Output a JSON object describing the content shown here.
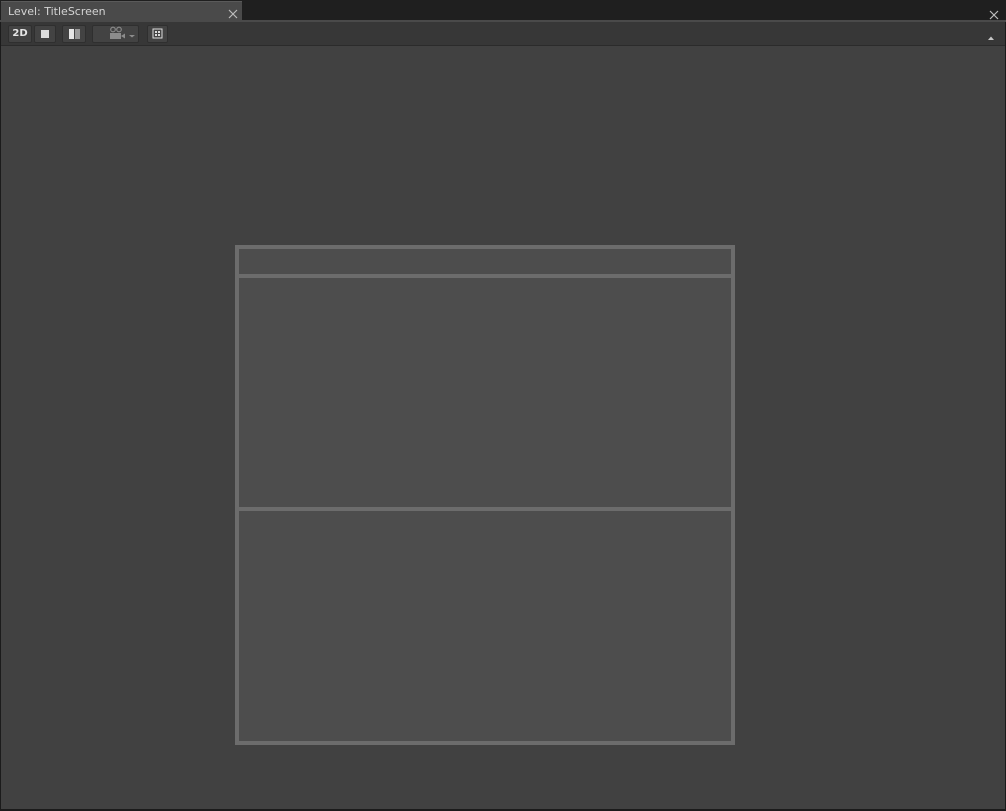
{
  "tab": {
    "title": "Level: TitleScreen"
  },
  "toolbar": {
    "mode_2d_label": "2D",
    "buttons": [
      {
        "name": "view-2d",
        "icon": "text-2d"
      },
      {
        "name": "single-view",
        "icon": "square-icon"
      },
      {
        "name": "split-view",
        "icon": "split-layout-icon"
      },
      {
        "name": "camera-select",
        "icon": "camera-icon"
      },
      {
        "name": "grid-toggle",
        "icon": "grid-dots-icon"
      }
    ]
  },
  "colors": {
    "background": "#414141",
    "canvas_fill": "#4d4d4d",
    "canvas_border": "#6c6c6c",
    "toolbar": "#373737",
    "tab_active": "#4a4a4a"
  }
}
